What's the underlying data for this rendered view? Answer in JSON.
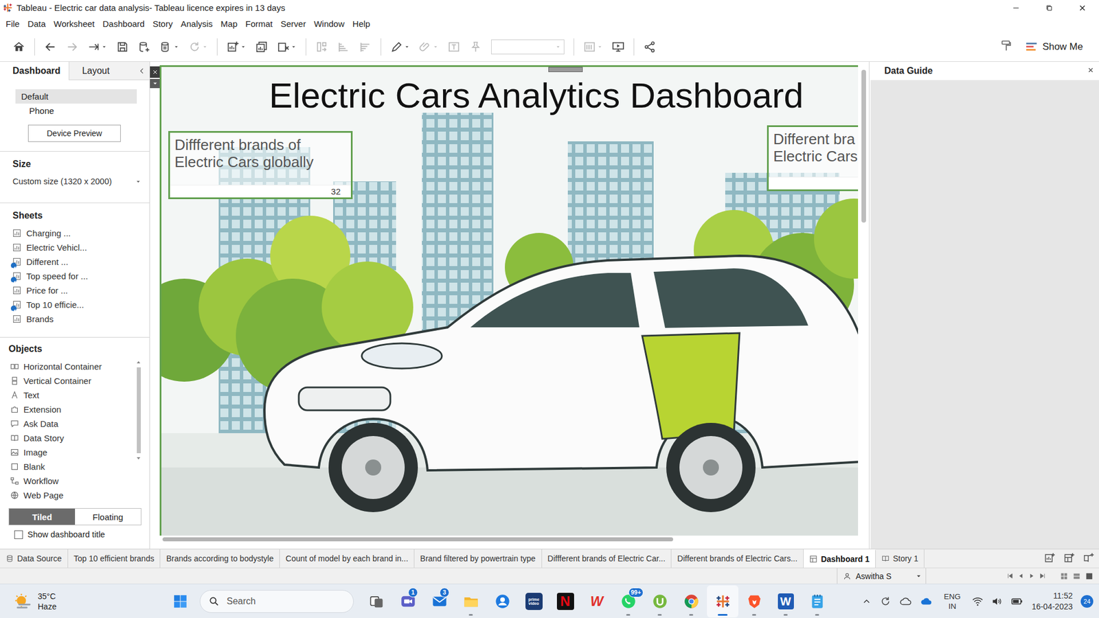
{
  "window": {
    "title": "Tableau - Electric car data analysis- Tableau licence expires in 13 days"
  },
  "menu": [
    "File",
    "Data",
    "Worksheet",
    "Dashboard",
    "Story",
    "Analysis",
    "Map",
    "Format",
    "Server",
    "Window",
    "Help"
  ],
  "toolbar": {
    "buttons": [
      {
        "kind": "home",
        "disabled": false,
        "dropdown": false
      },
      {
        "kind": "separator",
        "disabled": false,
        "dropdown": false
      },
      {
        "kind": "back",
        "disabled": false,
        "dropdown": false
      },
      {
        "kind": "forward",
        "disabled": true,
        "dropdown": false
      },
      {
        "kind": "swapdata",
        "disabled": false,
        "dropdown": true
      },
      {
        "kind": "save",
        "disabled": false,
        "dropdown": false
      },
      {
        "kind": "newds",
        "disabled": false,
        "dropdown": false
      },
      {
        "kind": "pause",
        "disabled": false,
        "dropdown": true
      },
      {
        "kind": "refresh",
        "disabled": true,
        "dropdown": true
      },
      {
        "kind": "separator",
        "disabled": false,
        "dropdown": false
      },
      {
        "kind": "newsheet",
        "disabled": false,
        "dropdown": true
      },
      {
        "kind": "duplicate",
        "disabled": false,
        "dropdown": false
      },
      {
        "kind": "clear",
        "disabled": false,
        "dropdown": true
      },
      {
        "kind": "separator",
        "disabled": false,
        "dropdown": false
      },
      {
        "kind": "swaprows",
        "disabled": true,
        "dropdown": false
      },
      {
        "kind": "sortasc",
        "disabled": true,
        "dropdown": false
      },
      {
        "kind": "sortdesc",
        "disabled": true,
        "dropdown": false
      },
      {
        "kind": "separator",
        "disabled": false,
        "dropdown": false
      },
      {
        "kind": "highlight",
        "disabled": false,
        "dropdown": true
      },
      {
        "kind": "annotate",
        "disabled": true,
        "dropdown": true
      },
      {
        "kind": "label",
        "disabled": true,
        "dropdown": false
      },
      {
        "kind": "pin",
        "disabled": true,
        "dropdown": false
      },
      {
        "kind": "combo",
        "disabled": true,
        "dropdown": true
      },
      {
        "kind": "separator",
        "disabled": false,
        "dropdown": false
      },
      {
        "kind": "cards",
        "disabled": true,
        "dropdown": true
      },
      {
        "kind": "present",
        "disabled": false,
        "dropdown": false
      },
      {
        "kind": "separator",
        "disabled": false,
        "dropdown": false
      },
      {
        "kind": "share",
        "disabled": false,
        "dropdown": false
      }
    ],
    "show_me": "Show Me"
  },
  "left_panel": {
    "tabs": [
      {
        "label": "Dashboard",
        "selected": true
      },
      {
        "label": "Layout",
        "selected": false
      }
    ],
    "devices": [
      {
        "label": "Default",
        "selected": true
      },
      {
        "label": "Phone",
        "selected": false
      }
    ],
    "device_preview": "Device Preview",
    "size_heading": "Size",
    "size_value": "Custom size (1320 x 2000)",
    "sheets_heading": "Sheets",
    "sheets": [
      {
        "label": "Charging ...",
        "used": false
      },
      {
        "label": "Electric Vehicl...",
        "used": false
      },
      {
        "label": "Different ...",
        "used": true
      },
      {
        "label": "Top speed for ...",
        "used": true
      },
      {
        "label": "Price for ...",
        "used": false
      },
      {
        "label": "Top 10 efficie...",
        "used": true
      },
      {
        "label": "Brands",
        "used": false
      }
    ],
    "objects_heading": "Objects",
    "objects": [
      {
        "label": "Horizontal Container",
        "kind": "hcontainer"
      },
      {
        "label": "Vertical Container",
        "kind": "vcontainer"
      },
      {
        "label": "Text",
        "kind": "text"
      },
      {
        "label": "Extension",
        "kind": "extension"
      },
      {
        "label": "Ask Data",
        "kind": "askdata"
      },
      {
        "label": "Data Story",
        "kind": "datastory"
      },
      {
        "label": "Image",
        "kind": "image"
      },
      {
        "label": "Blank",
        "kind": "blank"
      },
      {
        "label": "Workflow",
        "kind": "workflow"
      },
      {
        "label": "Web Page",
        "kind": "webpage"
      }
    ],
    "layout_modes": [
      {
        "label": "Tiled",
        "selected": true
      },
      {
        "label": "Floating",
        "selected": false
      }
    ],
    "show_title": {
      "label": "Show dashboard title",
      "checked": false
    }
  },
  "dashboard": {
    "title": "Electric Cars Analytics Dashboard",
    "cards": [
      {
        "lines": [
          "Diffferent brands of",
          "Electric Cars globally"
        ],
        "value": "32"
      },
      {
        "lines": [
          "Different bra",
          "Electric Cars"
        ]
      }
    ]
  },
  "data_guide": {
    "title": "Data Guide"
  },
  "sheet_tabs": [
    {
      "label": "Data Source",
      "kind": "datasource",
      "selected": false
    },
    {
      "label": "Top 10 efficient brands",
      "kind": "worksheet",
      "selected": false
    },
    {
      "label": "Brands according to bodystyle",
      "kind": "worksheet",
      "selected": false
    },
    {
      "label": "Count of model by each brand in...",
      "kind": "worksheet",
      "selected": false
    },
    {
      "label": "Brand filtered by powertrain type",
      "kind": "worksheet",
      "selected": false
    },
    {
      "label": "Diffferent brands of Electric Car...",
      "kind": "worksheet",
      "selected": false
    },
    {
      "label": "Different brands of Electric Cars...",
      "kind": "worksheet",
      "selected": false
    },
    {
      "label": "Dashboard 1",
      "kind": "dashboard",
      "selected": true
    },
    {
      "label": "Story 1",
      "kind": "story",
      "selected": false
    }
  ],
  "status_bar": {
    "user": "Aswitha S"
  },
  "taskbar": {
    "weather": {
      "temperature": "35°C",
      "condition": "Haze"
    },
    "search": "Search",
    "apps": [
      {
        "kind": "taskview",
        "running": false,
        "active": false
      },
      {
        "kind": "teams",
        "badge": "1",
        "running": false,
        "active": false
      },
      {
        "kind": "mail",
        "badge": "3",
        "running": false,
        "active": false
      },
      {
        "kind": "explorer",
        "running": true,
        "active": false
      },
      {
        "kind": "profile",
        "running": false,
        "active": false
      },
      {
        "kind": "primevideo",
        "glyph": "prime video",
        "running": false,
        "active": false
      },
      {
        "kind": "netflix",
        "glyph": "N",
        "running": false,
        "active": false
      },
      {
        "kind": "wps",
        "glyph": "W",
        "running": false,
        "active": false
      },
      {
        "kind": "whatsapp",
        "badge": "99+",
        "running": true,
        "active": false
      },
      {
        "kind": "utorrent",
        "running": true,
        "active": false
      },
      {
        "kind": "chrome",
        "running": true,
        "active": false
      },
      {
        "kind": "tableau",
        "running": true,
        "active": true
      },
      {
        "kind": "brave",
        "running": true,
        "active": false
      },
      {
        "kind": "word",
        "glyph": "W",
        "running": true,
        "active": false
      },
      {
        "kind": "notepad",
        "running": true,
        "active": false
      }
    ],
    "tray": {
      "language": "ENG",
      "region": "IN",
      "time": "11:52",
      "date": "16-04-2023",
      "notifications": "24"
    }
  }
}
